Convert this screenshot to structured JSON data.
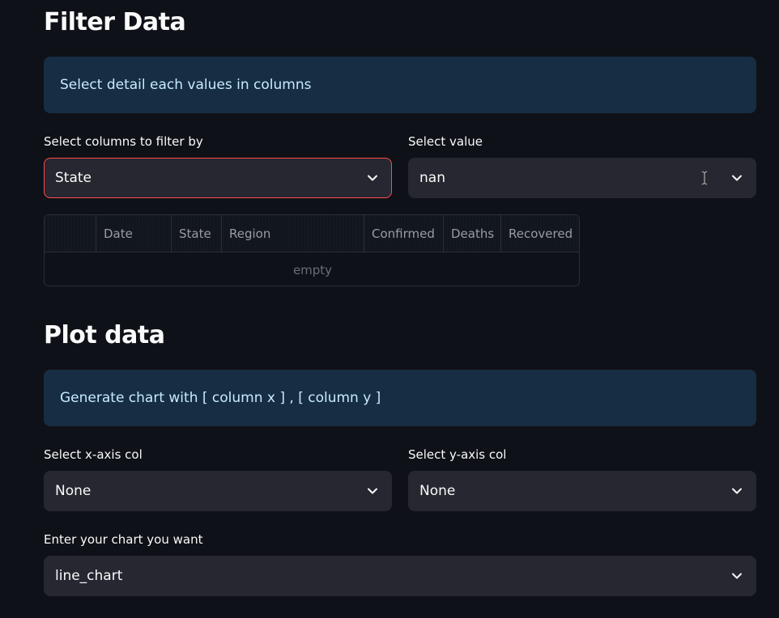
{
  "filter_section": {
    "title": "Filter Data",
    "info": "Select detail each values in columns",
    "column_select": {
      "label": "Select columns to filter by",
      "value": "State",
      "icon": "chevron-down-icon"
    },
    "value_select": {
      "label": "Select value",
      "value": "nan",
      "icon": "chevron-down-icon"
    },
    "table": {
      "columns": [
        "",
        "Date",
        "State",
        "Region",
        "Confirmed",
        "Deaths",
        "Recovered"
      ],
      "empty_text": "empty"
    }
  },
  "plot_section": {
    "title": "Plot data",
    "info": "Generate chart with [ column x ] , [ column y ]",
    "x_select": {
      "label": "Select x-axis col",
      "value": "None"
    },
    "y_select": {
      "label": "Select y-axis col",
      "value": "None"
    },
    "chart_select": {
      "label": "Enter your chart you want",
      "value": "line_chart"
    }
  },
  "colors": {
    "background": "#0e1117",
    "info_bg": "#172d43",
    "info_text": "#c7ebff",
    "select_bg": "#262730",
    "focus_border": "#ff4b4b"
  }
}
